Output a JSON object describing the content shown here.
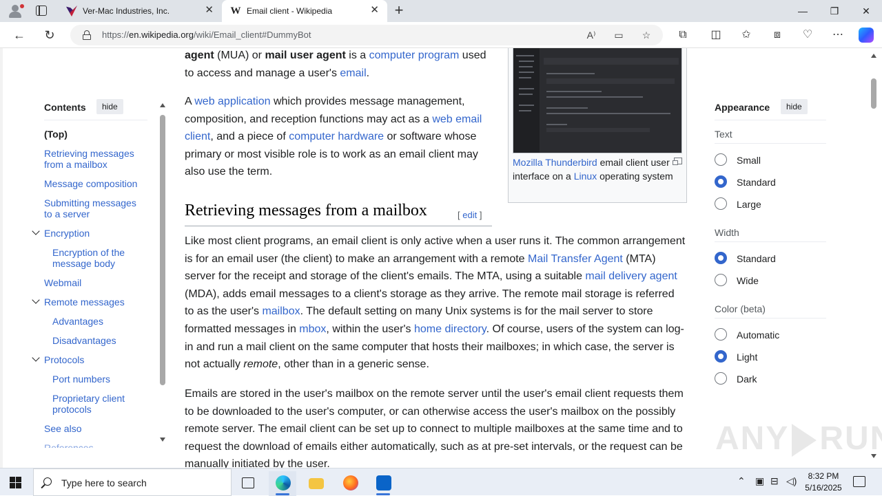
{
  "browser": {
    "tabs": [
      {
        "title": "Ver-Mac Industries, Inc.",
        "active": false
      },
      {
        "title": "Email client - Wikipedia",
        "active": true
      }
    ],
    "close_glyph": "✕",
    "new_tab_glyph": "+",
    "window_controls": {
      "minimize": "—",
      "maximize": "❐",
      "close": "✕"
    },
    "url_prefix": "https://",
    "url_domain": "en.wikipedia.org",
    "url_path": "/wiki/Email_client#DummyBot",
    "nav_glyphs": {
      "back": "←",
      "reload": "↻"
    }
  },
  "toc": {
    "title": "Contents",
    "hide_label": "hide",
    "items": [
      {
        "label": "(Top)",
        "level": 0,
        "top": true
      },
      {
        "label": "Retrieving messages from a mailbox",
        "level": 1
      },
      {
        "label": "Message composition",
        "level": 1
      },
      {
        "label": "Submitting messages to a server",
        "level": 1
      },
      {
        "label": "Encryption",
        "level": 1,
        "expandable": true
      },
      {
        "label": "Encryption of the message body",
        "level": 2
      },
      {
        "label": "Webmail",
        "level": 1
      },
      {
        "label": "Remote messages",
        "level": 1,
        "expandable": true
      },
      {
        "label": "Advantages",
        "level": 2
      },
      {
        "label": "Disadvantages",
        "level": 2
      },
      {
        "label": "Protocols",
        "level": 1,
        "expandable": true
      },
      {
        "label": "Port numbers",
        "level": 2
      },
      {
        "label": "Proprietary client protocols",
        "level": 2
      },
      {
        "label": "See also",
        "level": 1
      },
      {
        "label": "References",
        "level": 1
      }
    ]
  },
  "article": {
    "intro_bold1": "agent",
    "intro_t1": " (MUA) or ",
    "intro_bold2": "mail user agent",
    "intro_t2": " is a ",
    "intro_link1": "computer program",
    "intro_t3": " used to access and manage a user's ",
    "intro_link2": "email",
    "intro_t4": ".",
    "p2_t1": "A ",
    "p2_link1": "web application",
    "p2_t2": " which provides message management, composition, and reception functions may act as a ",
    "p2_link2": "web email client",
    "p2_t3": ", and a piece of ",
    "p2_link3": "computer hardware",
    "p2_t4": " or software whose primary or most visible role is to work as an email client may also use the term.",
    "section_title": "Retrieving messages from a mailbox",
    "edit_label": "edit",
    "p3_t1": "Like most client programs, an email client is only active when a user runs it. The common arrangement is for an email user (the client) to make an arrangement with a remote ",
    "p3_link1": "Mail Transfer Agent",
    "p3_t2": " (MTA) server for the receipt and storage of the client's emails. The MTA, using a suitable ",
    "p3_link2": "mail delivery agent",
    "p3_t3": " (MDA), adds email messages to a client's storage as they arrive. The remote mail storage is referred to as the user's ",
    "p3_link3": "mailbox",
    "p3_t4": ". The default setting on many Unix systems is for the mail server to store formatted messages in ",
    "p3_link4": "mbox",
    "p3_t5": ", within the user's ",
    "p3_link5": "home directory",
    "p3_t6": ". Of course, users of the system can log-in and run a mail client on the same computer that hosts their mailboxes; in which case, the server is not actually ",
    "p3_em": "remote",
    "p3_t7": ", other than in a generic sense.",
    "p4": "Emails are stored in the user's mailbox on the remote server until the user's email client requests them to be downloaded to the user's computer, or can otherwise access the user's mailbox on the possibly remote server. The email client can be set up to connect to multiple mailboxes at the same time and to request the download of emails either automatically, such as at pre-set intervals, or the request can be manually initiated by the user.",
    "caption_link1": "Mozilla Thunderbird",
    "caption_t1": " email client user interface on a ",
    "caption_link2": "Linux",
    "caption_t2": " operating system"
  },
  "appearance": {
    "title": "Appearance",
    "hide_label": "hide",
    "groups": [
      {
        "label": "Text",
        "options": [
          "Small",
          "Standard",
          "Large"
        ],
        "selected": "Standard"
      },
      {
        "label": "Width",
        "options": [
          "Standard",
          "Wide"
        ],
        "selected": "Standard"
      },
      {
        "label": "Color (beta)",
        "options": [
          "Automatic",
          "Light",
          "Dark"
        ],
        "selected": "Light"
      }
    ]
  },
  "watermark": {
    "left": "ANY",
    "right": "RUN"
  },
  "taskbar": {
    "search_placeholder": "Type here to search",
    "time": "8:32 PM",
    "date": "5/16/2025"
  },
  "colors": {
    "link": "#3366cc",
    "accent": "#3366cc"
  }
}
